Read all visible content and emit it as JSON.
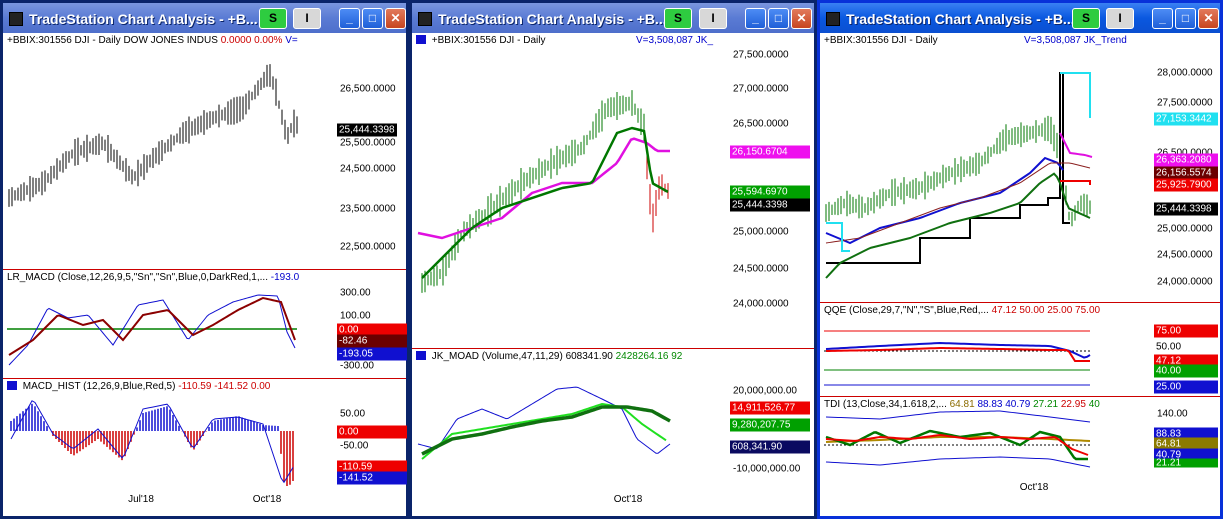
{
  "windows": [
    {
      "title": "TradeStation Chart Analysis - +B...",
      "s_label": "S",
      "i_label": "I",
      "panes": {
        "price": {
          "header": "+BBIX:301556 DJI - Daily  DOW JONES INDUS",
          "header_val1": "0.0000",
          "header_val2": "0.00%",
          "header_val3": "V=",
          "axis": [
            "26,500.0000",
            "25,500.0000",
            "24,500.0000",
            "23,500.0000",
            "22,500.0000"
          ],
          "last_box": "25,444.3398"
        },
        "macd": {
          "header": "LR_MACD (Close,12,26,9,5,\"Sn\",\"Sn\",Blue,0,DarkRed,1,...",
          "header_val": "-193.0",
          "axis": [
            "300.00",
            "100.00",
            "-300.00"
          ],
          "boxes": [
            "0.00",
            "-82.46",
            "-193.05"
          ]
        },
        "hist": {
          "header": "MACD_HIST (12,26,9,Blue,Red,5)",
          "header_vals": [
            "-110.59",
            "-141.52",
            "0.00"
          ],
          "axis": [
            "50.00",
            "-50.00"
          ],
          "boxes": [
            "0.00",
            "-110.59",
            "-141.52"
          ]
        }
      },
      "dates": [
        "Jul'18",
        "Oct'18"
      ]
    },
    {
      "title": "TradeStation Chart Analysis - +B...",
      "s_label": "S",
      "i_label": "I",
      "panes": {
        "price": {
          "header": "+BBIX:301556 DJI - Daily",
          "header_right": "V=3,508,087  JK_",
          "axis": [
            "27,500.0000",
            "27,000.0000",
            "26,500.0000",
            "25,000.0000",
            "24,500.0000",
            "24,000.0000"
          ],
          "boxes": [
            "26,150.6704",
            "25,594.6970",
            "25,444.3398"
          ]
        },
        "moad": {
          "header": "JK_MOAD (Volume,47,11,29)",
          "header_vals": [
            "608341.90",
            "2428264.16",
            "92"
          ],
          "axis": [
            "20,000,000.00",
            "-10,000,000.00"
          ],
          "boxes": [
            "14,911,526.77",
            "9,280,207.75",
            "608,341.90"
          ]
        }
      },
      "dates": [
        "Oct'18"
      ]
    },
    {
      "title": "TradeStation Chart Analysis - +B...",
      "s_label": "S",
      "i_label": "I",
      "panes": {
        "price": {
          "header": "+BBIX:301556 DJI - Daily",
          "header_right": "V=3,508,087  JK_Trend",
          "axis": [
            "28,000.0000",
            "27,500.0000",
            "26,500.0000",
            "25,000.0000",
            "24,500.0000",
            "24,000.0000"
          ],
          "boxes": [
            "27,153.3442",
            "26,363.2080",
            "26,156.5574",
            "25,925.7900",
            "25,444.3398"
          ]
        },
        "qqe": {
          "header": "QQE (Close,29,7,\"N\",\"S\",Blue,Red,...",
          "header_vals": [
            "47.12",
            "50.00",
            "25.00",
            "75.00"
          ],
          "boxes": [
            "75.00",
            "50.00",
            "47.12",
            "40.00",
            "25.00"
          ]
        },
        "tdi": {
          "header": "TDI (13,Close,34,1.618,2,...",
          "header_vals": [
            "64.81",
            "88.83",
            "40.79",
            "27.21",
            "22.95",
            "40"
          ],
          "axis": [
            "140.00"
          ],
          "boxes": [
            "88.83",
            "64.81",
            "40.79",
            "21.21"
          ]
        }
      },
      "dates": [
        "Oct'18"
      ]
    }
  ],
  "colors": {
    "bars": "#000000",
    "macd_line": "#8b0000",
    "signal": "#1010d0",
    "zero_line": "#008000",
    "hist_pos": "#1010d0",
    "hist_neg": "#cc0000",
    "ema_green": "#007700",
    "ema_magenta": "#e010e0",
    "cyan": "#20e0f0",
    "red_box": "#ee0000",
    "magenta_box": "#ee10ee",
    "green_box": "#00a000",
    "black_box": "#000000"
  }
}
